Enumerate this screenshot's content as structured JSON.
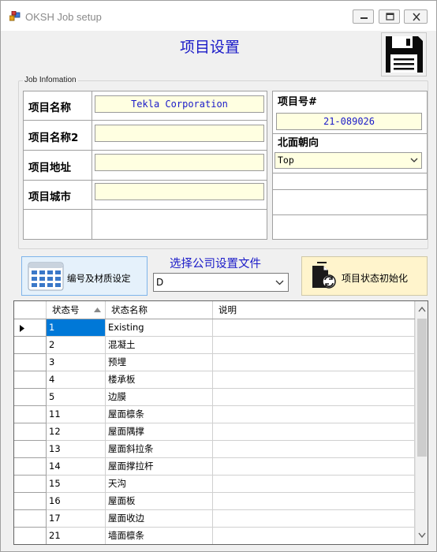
{
  "window": {
    "title": "OKSH Job setup",
    "main_title": "项目设置"
  },
  "job_info": {
    "legend": "Job Infomation",
    "rows": [
      {
        "label": "项目名称",
        "value": "Tekla Corporation"
      },
      {
        "label": "项目名称2",
        "value": ""
      },
      {
        "label": "项目地址",
        "value": ""
      },
      {
        "label": "项目城市",
        "value": ""
      }
    ]
  },
  "project_side": {
    "number_label": "项目号#",
    "number_value": "21-089026",
    "north_label": "北面朝向",
    "north_value": "Top"
  },
  "actions": {
    "numbering_button": "编号及材质设定",
    "company_file_label": "选择公司设置文件",
    "company_file_value": "D",
    "init_button": "项目状态初始化"
  },
  "grid": {
    "columns": [
      "状态号",
      "状态名称",
      "说明"
    ],
    "rows": [
      {
        "id": "1",
        "name": "Existing",
        "desc": ""
      },
      {
        "id": "2",
        "name": "混凝土",
        "desc": ""
      },
      {
        "id": "3",
        "name": "预埋",
        "desc": ""
      },
      {
        "id": "4",
        "name": "楼承板",
        "desc": ""
      },
      {
        "id": "5",
        "name": "边膜",
        "desc": ""
      },
      {
        "id": "11",
        "name": "屋面檩条",
        "desc": ""
      },
      {
        "id": "12",
        "name": "屋面隅撑",
        "desc": ""
      },
      {
        "id": "13",
        "name": "屋面斜拉条",
        "desc": ""
      },
      {
        "id": "14",
        "name": "屋面撑拉杆",
        "desc": ""
      },
      {
        "id": "15",
        "name": "天沟",
        "desc": ""
      },
      {
        "id": "16",
        "name": "屋面板",
        "desc": ""
      },
      {
        "id": "17",
        "name": "屋面收边",
        "desc": ""
      },
      {
        "id": "21",
        "name": "墙面檩条",
        "desc": ""
      }
    ]
  },
  "colors": {
    "accent_blue": "#1a1ac8",
    "input_yellow": "#ffffe1",
    "selection": "#0078d7"
  }
}
